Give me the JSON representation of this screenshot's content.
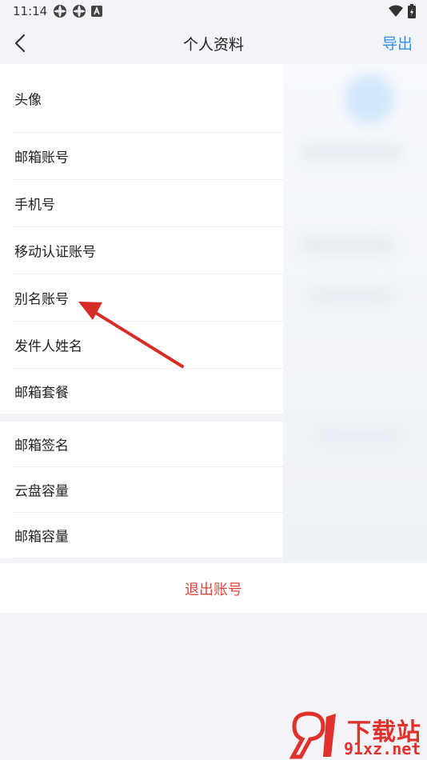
{
  "status_bar": {
    "time": "11:14"
  },
  "header": {
    "title": "个人资料",
    "export_label": "导出"
  },
  "list": {
    "section1": [
      {
        "label": "头像"
      },
      {
        "label": "邮箱账号"
      },
      {
        "label": "手机号"
      },
      {
        "label": "移动认证账号"
      },
      {
        "label": "别名账号"
      },
      {
        "label": "发件人姓名"
      },
      {
        "label": "邮箱套餐"
      }
    ],
    "section2": [
      {
        "label": "邮箱签名"
      },
      {
        "label": "云盘容量"
      },
      {
        "label": "邮箱容量"
      }
    ]
  },
  "logout_label": "退出账号",
  "watermark": {
    "line1": "下载站",
    "line2": "91xz.net"
  },
  "colors": {
    "accent": "#2f8ef0",
    "danger": "#e5433b",
    "annotation": "#e0312d"
  }
}
